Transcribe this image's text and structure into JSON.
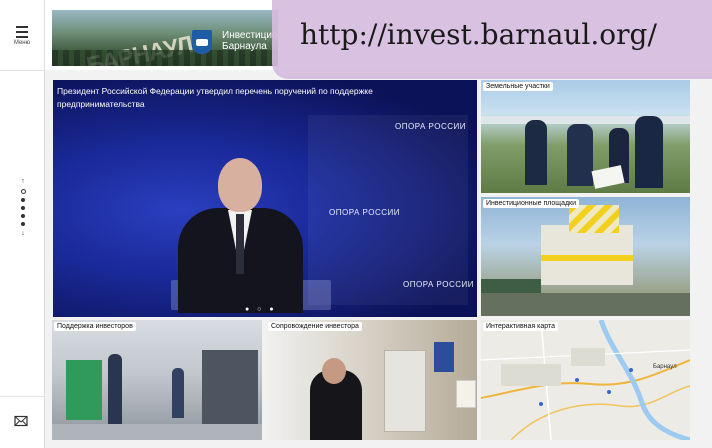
{
  "sidebar": {
    "menu_label": "Меню",
    "nav_up": "↑",
    "nav_down": "↓",
    "mail_icon": "mail-icon"
  },
  "header": {
    "brand_line1": "Инвестиционный",
    "brand_line2": "Барнаула",
    "city_banner_text": "БАРНАУЛ"
  },
  "watermark": {
    "url": "http://invest.barnaul.org/"
  },
  "hero": {
    "title": "Президент Российской Федерации утвердил перечень поручений по поддержке предпринимательства",
    "backdrop_text": "ОПОРА РОССИИ",
    "carousel_dots": "● ○ ●"
  },
  "tiles": [
    {
      "caption": "Земельные участки"
    },
    {
      "caption": "Инвестиционные площадки"
    },
    {
      "caption": "Поддержка инвесторов"
    },
    {
      "caption": "Сопровождение инвестора"
    },
    {
      "caption": "Интерактивная карта"
    }
  ],
  "map": {
    "city_label": "Барнаул"
  },
  "colors": {
    "hero_blue": "#1a2a9a",
    "watermark_bg": "#d6bce0",
    "logo_blue": "#1e5ca8"
  }
}
